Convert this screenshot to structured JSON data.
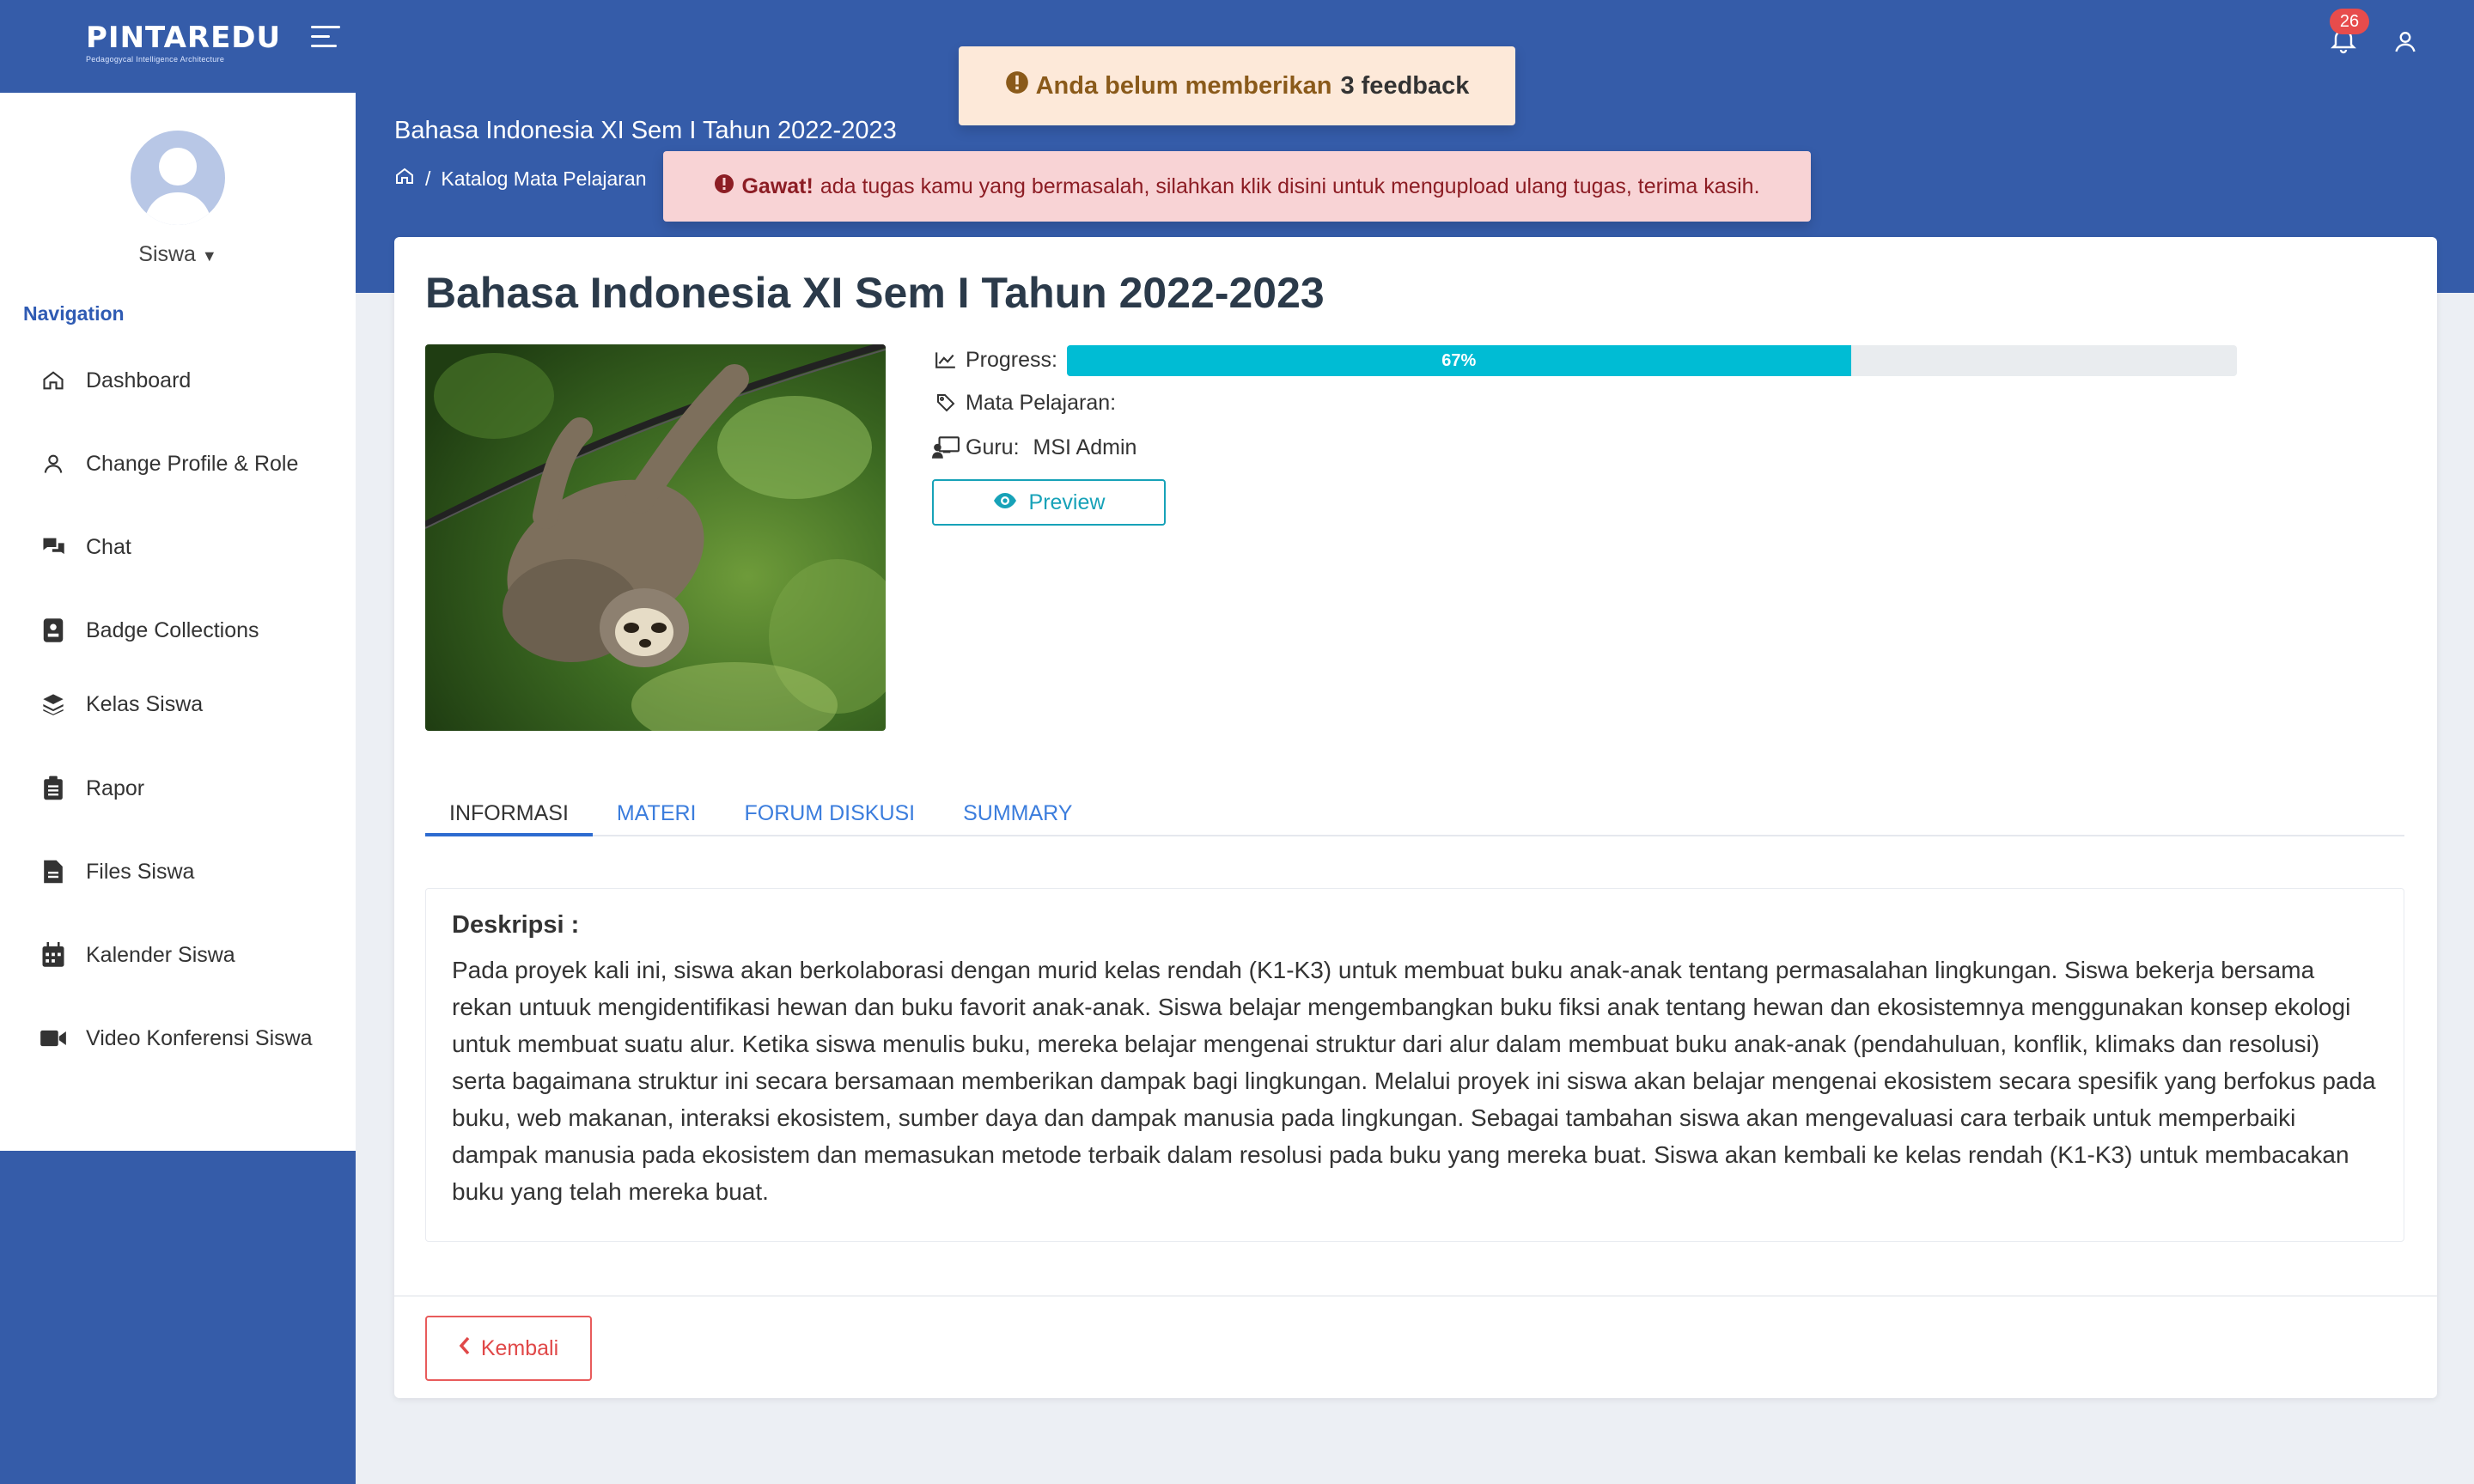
{
  "header": {
    "logo_text": "PINTAREDU",
    "logo_subtitle": "Pedagogycal Intelligence Architecture",
    "notification_count": "26"
  },
  "sidebar": {
    "role_label": "Siswa",
    "nav_title": "Navigation",
    "items": [
      {
        "label": "Dashboard",
        "icon": "home-icon"
      },
      {
        "label": "Change Profile & Role",
        "icon": "user-icon"
      },
      {
        "label": "Chat",
        "icon": "chat-icon"
      },
      {
        "label": "Badge Collections",
        "icon": "badge-icon"
      },
      {
        "label": "Kelas Siswa",
        "icon": "layers-icon"
      },
      {
        "label": "Rapor",
        "icon": "clipboard-icon"
      },
      {
        "label": "Files Siswa",
        "icon": "file-icon"
      },
      {
        "label": "Kalender Siswa",
        "icon": "calendar-icon"
      },
      {
        "label": "Video Konferensi Siswa",
        "icon": "video-icon"
      }
    ]
  },
  "page": {
    "header_title": "Bahasa Indonesia XI Sem I Tahun 2022-2023",
    "breadcrumb": [
      "Katalog Mata Pelajaran"
    ]
  },
  "toasts": {
    "warning_text": "Anda belum memberikan",
    "warning_count": "3 feedback",
    "danger_bold": "Gawat!",
    "danger_text": "ada tugas kamu yang bermasalah, silahkan klik disini untuk mengupload ulang tugas, terima kasih."
  },
  "course": {
    "title": "Bahasa Indonesia XI Sem I Tahun 2022-2023",
    "progress_label": "Progress:",
    "progress_percent": 67,
    "progress_text": "67%",
    "subject_label": "Mata Pelajaran:",
    "subject_value": "",
    "teacher_label": "Guru:",
    "teacher_value": "MSI Admin",
    "preview_label": "Preview"
  },
  "tabs": [
    {
      "label": "INFORMASI",
      "active": true
    },
    {
      "label": "MATERI",
      "active": false
    },
    {
      "label": "FORUM DISKUSI",
      "active": false
    },
    {
      "label": "SUMMARY",
      "active": false
    }
  ],
  "description": {
    "title": "Deskripsi :",
    "body": "Pada proyek kali ini, siswa akan berkolaborasi dengan murid kelas rendah (K1-K3) untuk membuat buku anak-anak tentang permasalahan lingkungan. Siswa bekerja bersama rekan untuuk mengidentifikasi hewan dan buku favorit anak-anak. Siswa belajar mengembangkan buku fiksi anak tentang hewan dan ekosistemnya menggunakan konsep ekologi untuk membuat suatu alur. Ketika siswa menulis buku, mereka belajar mengenai struktur dari alur dalam membuat buku anak-anak (pendahuluan, konflik, klimaks dan resolusi) serta bagaimana struktur ini secara bersamaan memberikan dampak bagi lingkungan. Melalui proyek ini siswa akan belajar mengenai ekosistem secara spesifik yang berfokus pada buku, web makanan, interaksi ekosistem, sumber daya dan dampak manusia pada lingkungan. Sebagai tambahan siswa akan mengevaluasi cara terbaik untuk memperbaiki dampak manusia pada ekosistem dan memasukan metode terbaik dalam resolusi pada buku yang mereka buat. Siswa akan kembali ke kelas rendah (K1-K3) untuk membacakan buku yang telah mereka buat."
  },
  "footer": {
    "back_label": "Kembali"
  },
  "colors": {
    "primary": "#355ca9",
    "progress": "#00bcd4",
    "info": "#17a2b8",
    "danger": "#e04848"
  }
}
